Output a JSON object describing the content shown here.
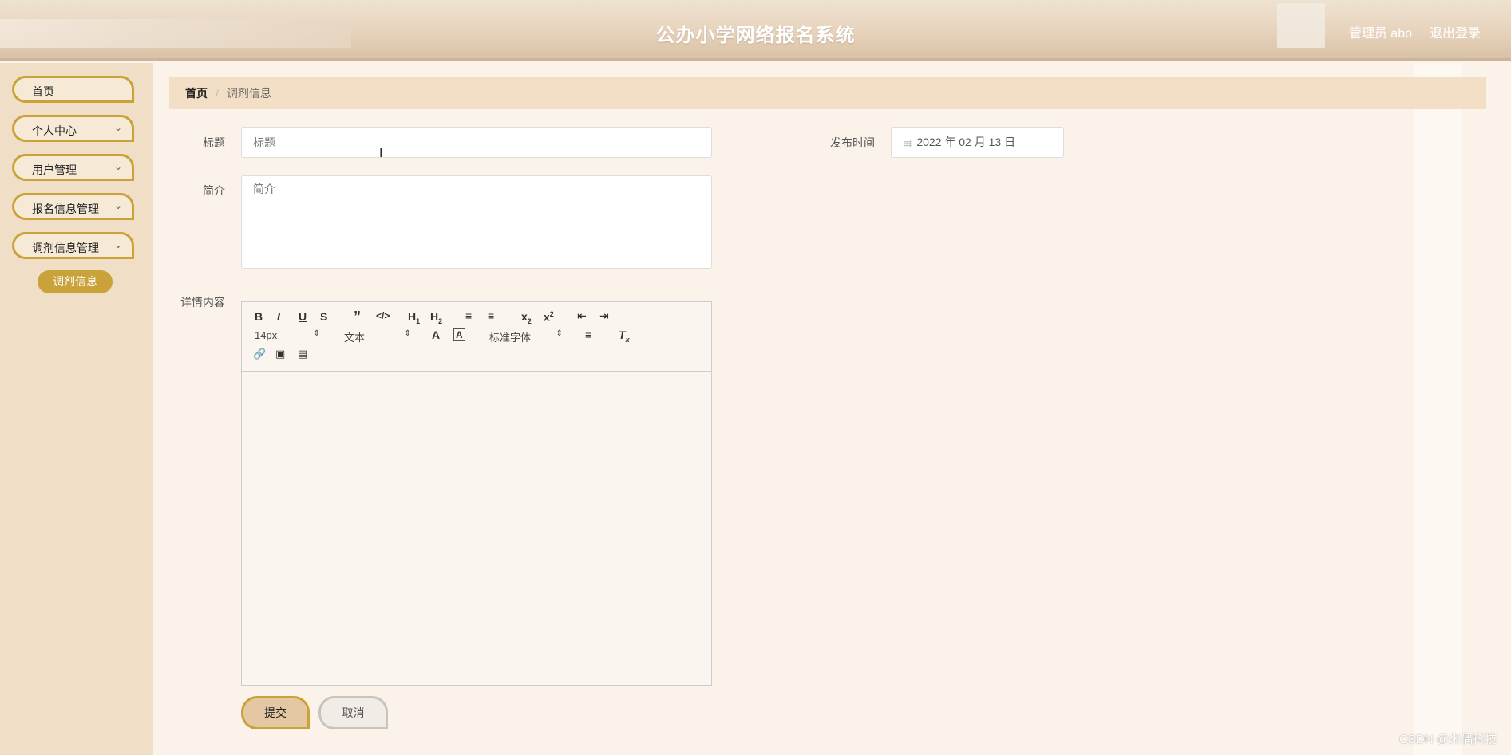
{
  "header": {
    "title": "公办小学网络报名系统",
    "admin": "管理员 abo",
    "logout": "退出登录"
  },
  "sidebar": {
    "items": [
      {
        "label": "首页"
      },
      {
        "label": "个人中心"
      },
      {
        "label": "用户管理"
      },
      {
        "label": "报名信息管理"
      },
      {
        "label": "调剂信息管理"
      }
    ],
    "sub_active": "调剂信息"
  },
  "breadcrumb": {
    "home": "首页",
    "sep": "/",
    "current": "调剂信息"
  },
  "form": {
    "title_label": "标题",
    "title_placeholder": "标题",
    "time_label": "发布时间",
    "time_value": "2022 年 02 月 13 日",
    "summary_label": "简介",
    "summary_placeholder": "简介",
    "detail_label": "详情内容"
  },
  "editor": {
    "size_select": "14px",
    "text_select": "文本",
    "font_select": "标准字体"
  },
  "buttons": {
    "submit": "提交",
    "cancel": "取消"
  },
  "watermark": "CSDN @米偶科技",
  "colors": {
    "accent": "#caa23a",
    "sidebar_bg": "#f0dfc6",
    "breadcrumb_bg": "#f2dfc5"
  }
}
